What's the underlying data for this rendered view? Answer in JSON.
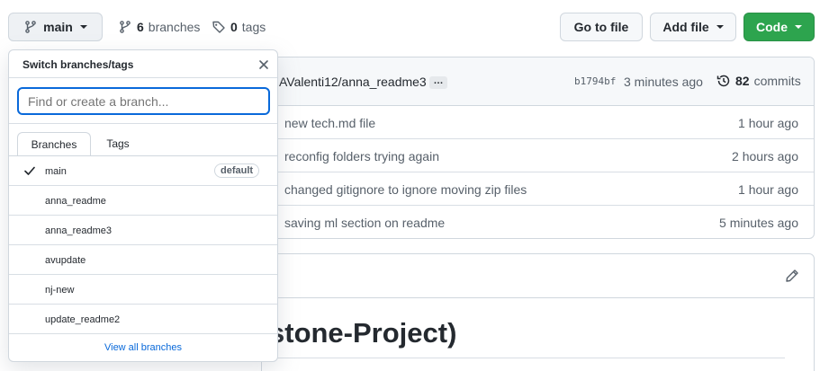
{
  "toolbar": {
    "branch_label": "main",
    "branches_count": "6",
    "branches_word": "branches",
    "tags_count": "0",
    "tags_word": "tags",
    "goto_file": "Go to file",
    "add_file": "Add file",
    "code": "Code"
  },
  "latest_commit": {
    "author_text": "AValenti12/anna_readme3",
    "ellipsis": "…",
    "sha": "b1794bf",
    "time": "3 minutes ago",
    "commits_count": "82",
    "commits_word": "commits"
  },
  "files": [
    {
      "message": "new tech.md file",
      "time": "1 hour ago"
    },
    {
      "message": "reconfig folders trying again",
      "time": "2 hours ago"
    },
    {
      "message": "changed gitignore to ignore moving zip files",
      "time": "1 hour ago"
    },
    {
      "message": "saving ml section on readme",
      "time": "5 minutes ago"
    }
  ],
  "readme": {
    "heading": "stone-Project)"
  },
  "dropdown": {
    "title": "Switch branches/tags",
    "placeholder": "Find or create a branch...",
    "tab_branches": "Branches",
    "tab_tags": "Tags",
    "default_badge": "default",
    "branches": [
      {
        "name": "main"
      },
      {
        "name": "anna_readme"
      },
      {
        "name": "anna_readme3"
      },
      {
        "name": "avupdate"
      },
      {
        "name": "nj-new"
      },
      {
        "name": "update_readme2"
      }
    ],
    "view_all": "View all branches"
  },
  "colors": {
    "accent": "#0969da",
    "code_green": "#2da44e",
    "border": "#d0d7de"
  }
}
